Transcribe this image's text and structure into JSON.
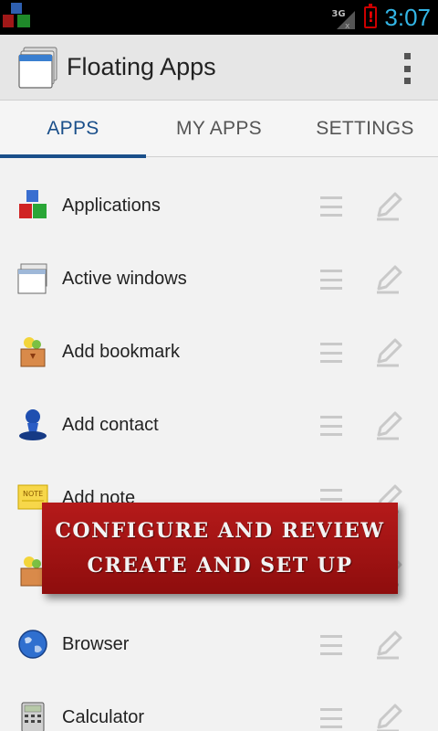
{
  "status_bar": {
    "network": "3G",
    "time": "3:07"
  },
  "action_bar": {
    "title": "Floating Apps",
    "icons": {
      "app": "floating-windows-icon",
      "menu": "overflow-menu-icon"
    }
  },
  "tabs": [
    {
      "label": "APPS",
      "active": true
    },
    {
      "label": "MY APPS",
      "active": false
    },
    {
      "label": "SETTINGS",
      "active": false
    }
  ],
  "list": {
    "items": [
      {
        "label": "Applications",
        "icon": "colored-cubes-icon"
      },
      {
        "label": "Active windows",
        "icon": "windows-stack-icon"
      },
      {
        "label": "Add bookmark",
        "icon": "bookmark-box-icon"
      },
      {
        "label": "Add contact",
        "icon": "contact-stamp-icon"
      },
      {
        "label": "Add note",
        "icon": "sticky-note-icon"
      },
      {
        "label": "",
        "icon": "bookmark-box-icon"
      },
      {
        "label": "Browser",
        "icon": "globe-icon"
      },
      {
        "label": "Calculator",
        "icon": "calculator-icon"
      }
    ]
  },
  "banner": {
    "line1": "CONFIGURE AND REVIEW",
    "line2": "CREATE AND SET UP"
  },
  "colors": {
    "accent": "#1a4f8a",
    "clock": "#33b5e5",
    "banner": "#a81414"
  }
}
